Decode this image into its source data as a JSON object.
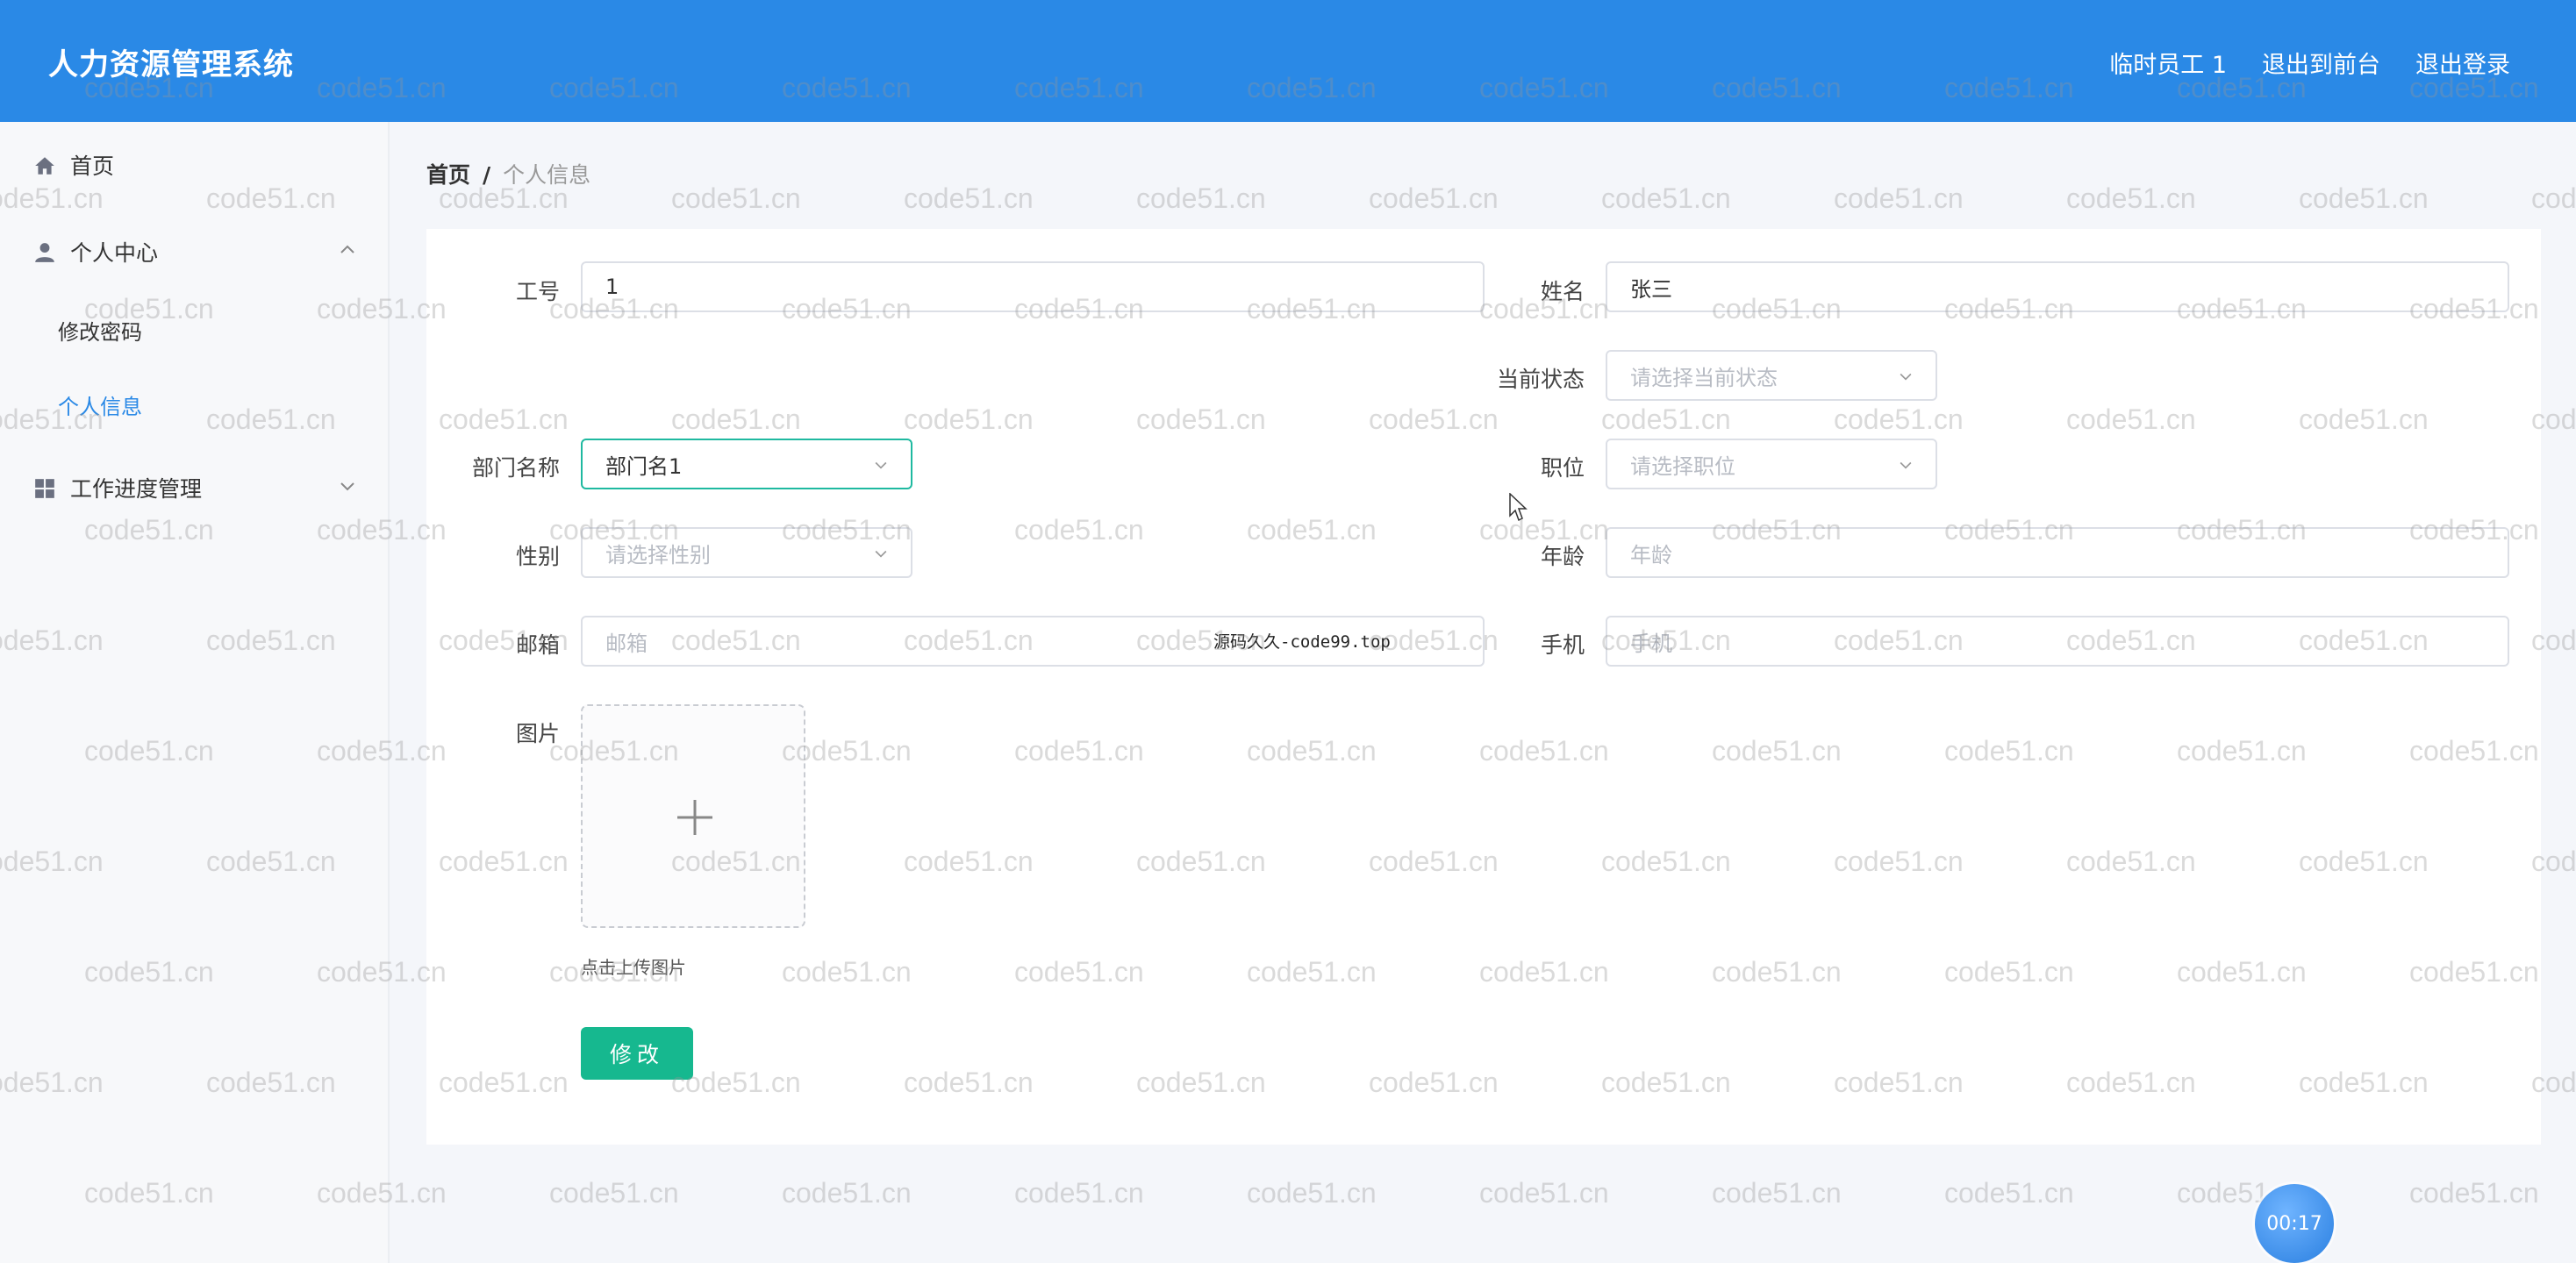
{
  "header": {
    "title": "人力资源管理系统",
    "links": [
      "临时员工 1",
      "退出到前台",
      "退出登录"
    ]
  },
  "sidebar": {
    "items": [
      {
        "label": "首页",
        "icon": "home-icon"
      },
      {
        "label": "个人中心",
        "icon": "user-icon",
        "expanded": true,
        "children": [
          "修改密码",
          "个人信息"
        ]
      },
      {
        "label": "工作进度管理",
        "icon": "grid-icon",
        "expanded": false
      }
    ],
    "active_child": "个人信息"
  },
  "breadcrumb": {
    "home": "首页",
    "separator": "/",
    "current": "个人信息"
  },
  "form": {
    "employee_id": {
      "label": "工号",
      "value": "1"
    },
    "name": {
      "label": "姓名",
      "value": "张三"
    },
    "status": {
      "label": "当前状态",
      "placeholder": "请选择当前状态"
    },
    "department": {
      "label": "部门名称",
      "value": "部门名1"
    },
    "position": {
      "label": "职位",
      "placeholder": "请选择职位"
    },
    "gender": {
      "label": "性别",
      "placeholder": "请选择性别"
    },
    "age": {
      "label": "年龄",
      "placeholder": "年龄"
    },
    "email": {
      "label": "邮箱",
      "placeholder": "邮箱"
    },
    "phone": {
      "label": "手机",
      "placeholder": "手机"
    },
    "image": {
      "label": "图片",
      "hint": "点击上传图片"
    },
    "submit_label": "修改"
  },
  "overlay_text": "源码久久-code99.top",
  "watermark_text": "code51.cn",
  "timer": "00:17",
  "colors": {
    "header": "#2a89e6",
    "accent": "#16b88f",
    "active": "#2a89e6"
  }
}
